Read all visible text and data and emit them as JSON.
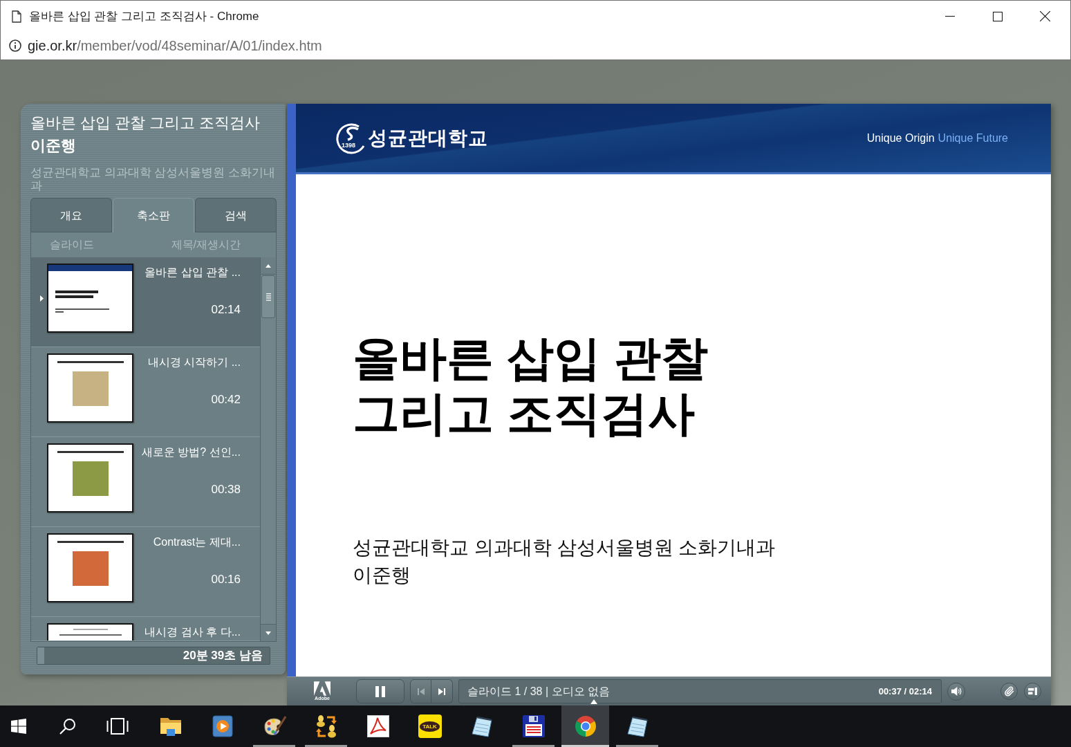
{
  "window": {
    "title": "올바른 삽입 관찰 그리고 조직검사 - Chrome"
  },
  "address_bar": {
    "host": "gie.or.kr",
    "path": "/member/vod/48seminar/A/01/index.htm"
  },
  "sidebar": {
    "title": "올바른 삽입 관찰 그리고 조직검사",
    "presenter": "이준행",
    "affiliation": "성균관대학교 의과대학 삼성서울병원 소화기내과",
    "tabs": [
      {
        "label": "개요",
        "selected": false
      },
      {
        "label": "축소판",
        "selected": true
      },
      {
        "label": "검색",
        "selected": false
      }
    ],
    "columns": [
      "슬라이드",
      "제목/재생시간"
    ],
    "slides": [
      {
        "title": "올바른 삽입 관찰 ...",
        "time": "02:14",
        "selected": true,
        "thumbnail": {
          "kind": "title"
        }
      },
      {
        "title": "내시경 시작하기 ...",
        "time": "00:42",
        "selected": false,
        "thumbnail": {
          "kind": "photo",
          "color": "#c6b283"
        }
      },
      {
        "title": "새로운 방법? 선인...",
        "time": "00:38",
        "selected": false,
        "thumbnail": {
          "kind": "photo",
          "color": "#8c9a46"
        }
      },
      {
        "title": "Contrast는 제대...",
        "time": "00:16",
        "selected": false,
        "thumbnail": {
          "kind": "photo",
          "color": "#d2693b"
        }
      },
      {
        "title": "내시경 검사 후 다...",
        "selected": false,
        "thumbnail": {
          "kind": "text"
        }
      }
    ],
    "remaining": {
      "text": "20분 39초 남음",
      "level": 0.03
    }
  },
  "slide": {
    "logo_year": "1398",
    "logo_text": "성균관대학교",
    "tagline": [
      "Unique Origin",
      "Unique Future"
    ],
    "title": "올바른 삽입 관찰\n그리고 조직검사",
    "affiliation": "성균관대학교 의과대학 삼성서울병원 소화기내과",
    "presenter": "이준행"
  },
  "player": {
    "logo_text": "Adobe",
    "playing": true,
    "previous": {
      "disabled": true
    },
    "next": {
      "disabled": false
    },
    "status": "슬라이드 1 / 38 | 오디오 없음",
    "time": "00:37 / 02:14",
    "level": 0.28
  },
  "taskbar": [
    {
      "kind": "start",
      "running": false,
      "active": false
    },
    {
      "kind": "search",
      "running": false,
      "active": false
    },
    {
      "kind": "task-view",
      "running": false,
      "active": false
    },
    {
      "kind": "folder",
      "running": false,
      "active": false
    },
    {
      "kind": "media",
      "running": false,
      "active": false
    },
    {
      "kind": "paint",
      "running": true,
      "active": false
    },
    {
      "kind": "people",
      "running": true,
      "active": false
    },
    {
      "kind": "pdf",
      "running": false,
      "active": false
    },
    {
      "kind": "chat",
      "label": "TALK",
      "running": false,
      "active": false
    },
    {
      "kind": "notepad",
      "running": false,
      "active": false
    },
    {
      "kind": "floppy",
      "running": true,
      "active": false
    },
    {
      "kind": "browser",
      "running": true,
      "active": true
    },
    {
      "kind": "notepad",
      "running": true,
      "active": false
    }
  ]
}
